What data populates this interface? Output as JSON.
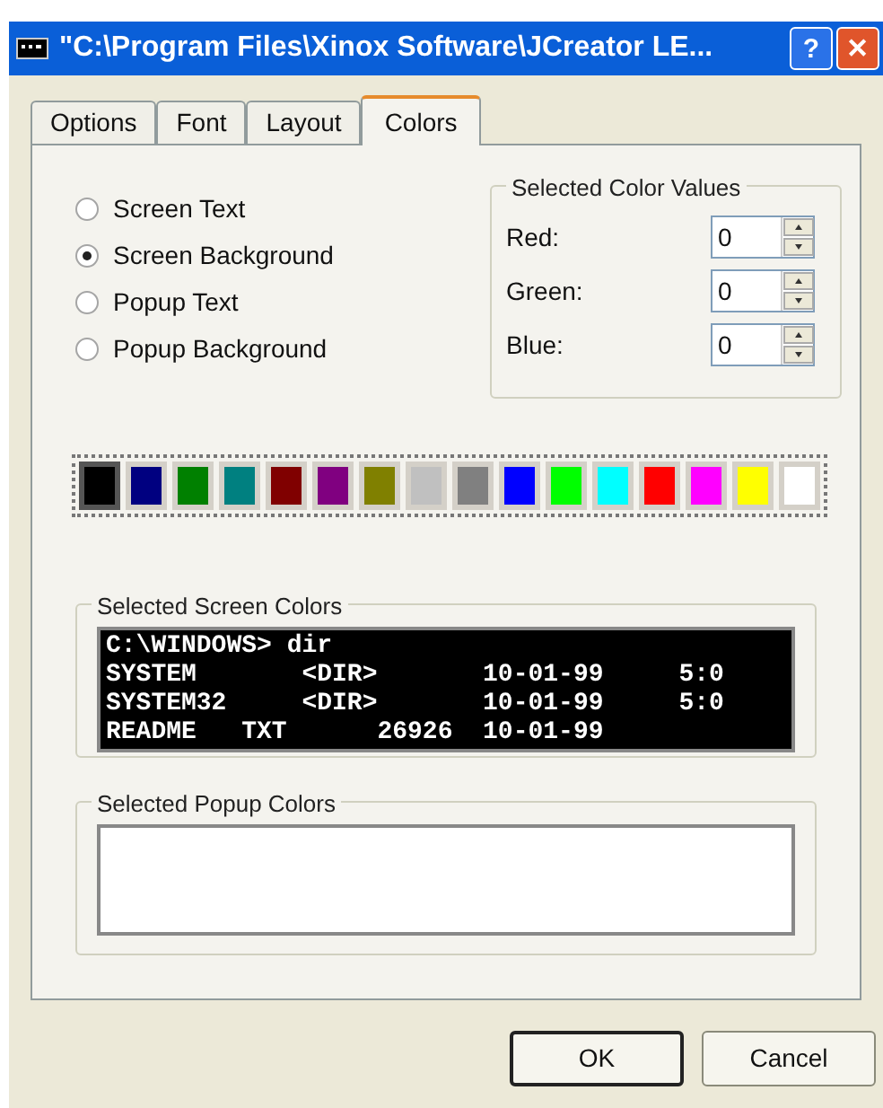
{
  "window": {
    "title": "\"C:\\Program Files\\Xinox Software\\JCreator LE..."
  },
  "title_buttons": [
    {
      "kind": "help",
      "label": "?"
    },
    {
      "kind": "close",
      "label": "✕"
    }
  ],
  "tabs": [
    {
      "label": "Options",
      "selected": false
    },
    {
      "label": "Font",
      "selected": false
    },
    {
      "label": "Layout",
      "selected": false
    },
    {
      "label": "Colors",
      "selected": true
    }
  ],
  "radios": [
    {
      "label": "Screen Text",
      "selected": false
    },
    {
      "label": "Screen Background",
      "selected": true
    },
    {
      "label": "Popup Text",
      "selected": false
    },
    {
      "label": "Popup Background",
      "selected": false
    }
  ],
  "color_values": {
    "title": "Selected Color Values",
    "fields": [
      {
        "label": "Red:",
        "value": "0"
      },
      {
        "label": "Green:",
        "value": "0"
      },
      {
        "label": "Blue:",
        "value": "0"
      }
    ]
  },
  "palette": [
    {
      "color": "#000000",
      "selected": true
    },
    {
      "color": "#000080",
      "selected": false
    },
    {
      "color": "#008000",
      "selected": false
    },
    {
      "color": "#008080",
      "selected": false
    },
    {
      "color": "#800000",
      "selected": false
    },
    {
      "color": "#800080",
      "selected": false
    },
    {
      "color": "#808000",
      "selected": false
    },
    {
      "color": "#c0c0c0",
      "selected": false
    },
    {
      "color": "#808080",
      "selected": false
    },
    {
      "color": "#0000ff",
      "selected": false
    },
    {
      "color": "#00ff00",
      "selected": false
    },
    {
      "color": "#00ffff",
      "selected": false
    },
    {
      "color": "#ff0000",
      "selected": false
    },
    {
      "color": "#ff00ff",
      "selected": false
    },
    {
      "color": "#ffff00",
      "selected": false
    },
    {
      "color": "#ffffff",
      "selected": false
    }
  ],
  "screen_colors": {
    "title": "Selected Screen Colors",
    "lines": [
      "C:\\WINDOWS> dir",
      "SYSTEM       <DIR>       10-01-99     5:0",
      "SYSTEM32     <DIR>       10-01-99     5:0",
      "README   TXT      26926  10-01-99"
    ]
  },
  "popup_colors": {
    "title": "Selected Popup Colors"
  },
  "buttons": [
    {
      "label": "OK",
      "default": true
    },
    {
      "label": "Cancel",
      "default": false
    }
  ]
}
